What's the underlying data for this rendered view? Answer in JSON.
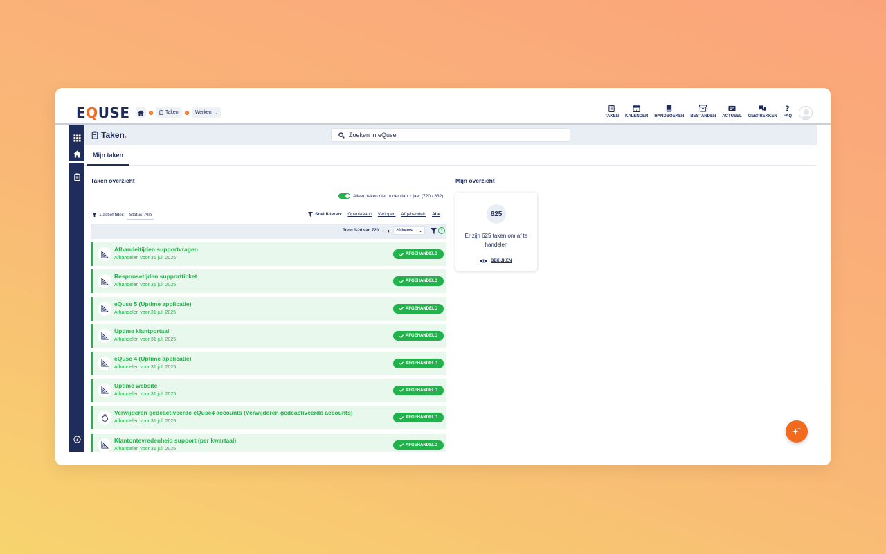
{
  "app": {
    "logo_prefix": "E",
    "logo_q": "Q",
    "logo_suffix": "USE"
  },
  "breadcrumb": {
    "taken": "Taken",
    "werken": "Werken"
  },
  "topnav": [
    {
      "label": "TAKEN",
      "icon": "clipboard-icon"
    },
    {
      "label": "KALENDER",
      "icon": "calendar-icon"
    },
    {
      "label": "HANDBOEKEN",
      "icon": "book-icon"
    },
    {
      "label": "BESTANDEN",
      "icon": "archive-icon"
    },
    {
      "label": "ACTUEEL",
      "icon": "news-icon"
    },
    {
      "label": "GESPREKKEN",
      "icon": "chat-icon"
    },
    {
      "label": "FAQ",
      "icon": "question-icon"
    }
  ],
  "page": {
    "title": "Taken",
    "title_dot": "."
  },
  "search": {
    "placeholder": "Zoeken in eQuse"
  },
  "tabs": {
    "mijn_taken": "Mijn taken"
  },
  "left": {
    "title": "Taken overzicht",
    "toggle_label": "Alleen taken niet ouder dan 1 jaar (720 / 832)",
    "active_filter": "1 actief filter:",
    "filter_chip": "Status: Alle",
    "quick_label": "Snel filteren:",
    "quick": [
      "Openstaand",
      "Verlopen",
      "Afgehandeld",
      "Alle"
    ],
    "pager_text": "Toon 1-20 van 720",
    "items_select": "20 items",
    "filter_count": "1"
  },
  "tasks": [
    {
      "title": "Afhandeltijden supportvragen",
      "sub": "Afhandelen voor 31 jul. 2025",
      "status": "AFGEHANDELD",
      "icon": "set-square-icon"
    },
    {
      "title": "Responsetijden supportticket",
      "sub": "Afhandelen voor 31 jul. 2025",
      "status": "AFGEHANDELD",
      "icon": "set-square-icon"
    },
    {
      "title": "eQuse 5 (Uptime applicatie)",
      "sub": "Afhandelen voor 31 jul. 2025",
      "status": "AFGEHANDELD",
      "icon": "set-square-icon"
    },
    {
      "title": "Uptime klantportaal",
      "sub": "Afhandelen voor 31 jul. 2025",
      "status": "AFGEHANDELD",
      "icon": "set-square-icon"
    },
    {
      "title": "eQuse 4 (Uptime applicatie)",
      "sub": "Afhandelen voor 31 jul. 2025",
      "status": "AFGEHANDELD",
      "icon": "set-square-icon"
    },
    {
      "title": "Uptime website",
      "sub": "Afhandelen voor 31 jul. 2025",
      "status": "AFGEHANDELD",
      "icon": "set-square-icon"
    },
    {
      "title": "Verwijderen gedeactiveerde eQuse4 accounts (Verwijderen gedeactiveerde accounts)",
      "sub": "Afhandelen voor 31 jul. 2025",
      "status": "AFGEHANDELD",
      "icon": "stopwatch-icon"
    },
    {
      "title": "Klantontevredenheid support (per kwartaal)",
      "sub": "Afhandelen voor 31 jul. 2025",
      "status": "AFGEHANDELD",
      "icon": "set-square-icon"
    }
  ],
  "right": {
    "title": "Mijn overzicht",
    "count": "625",
    "text": "Er zijn 625 taken om af te handelen",
    "link": "BEKIJKEN"
  },
  "colors": {
    "brand_navy": "#1f2d5a",
    "accent_orange": "#f26a1b",
    "success_green": "#22b24c"
  }
}
